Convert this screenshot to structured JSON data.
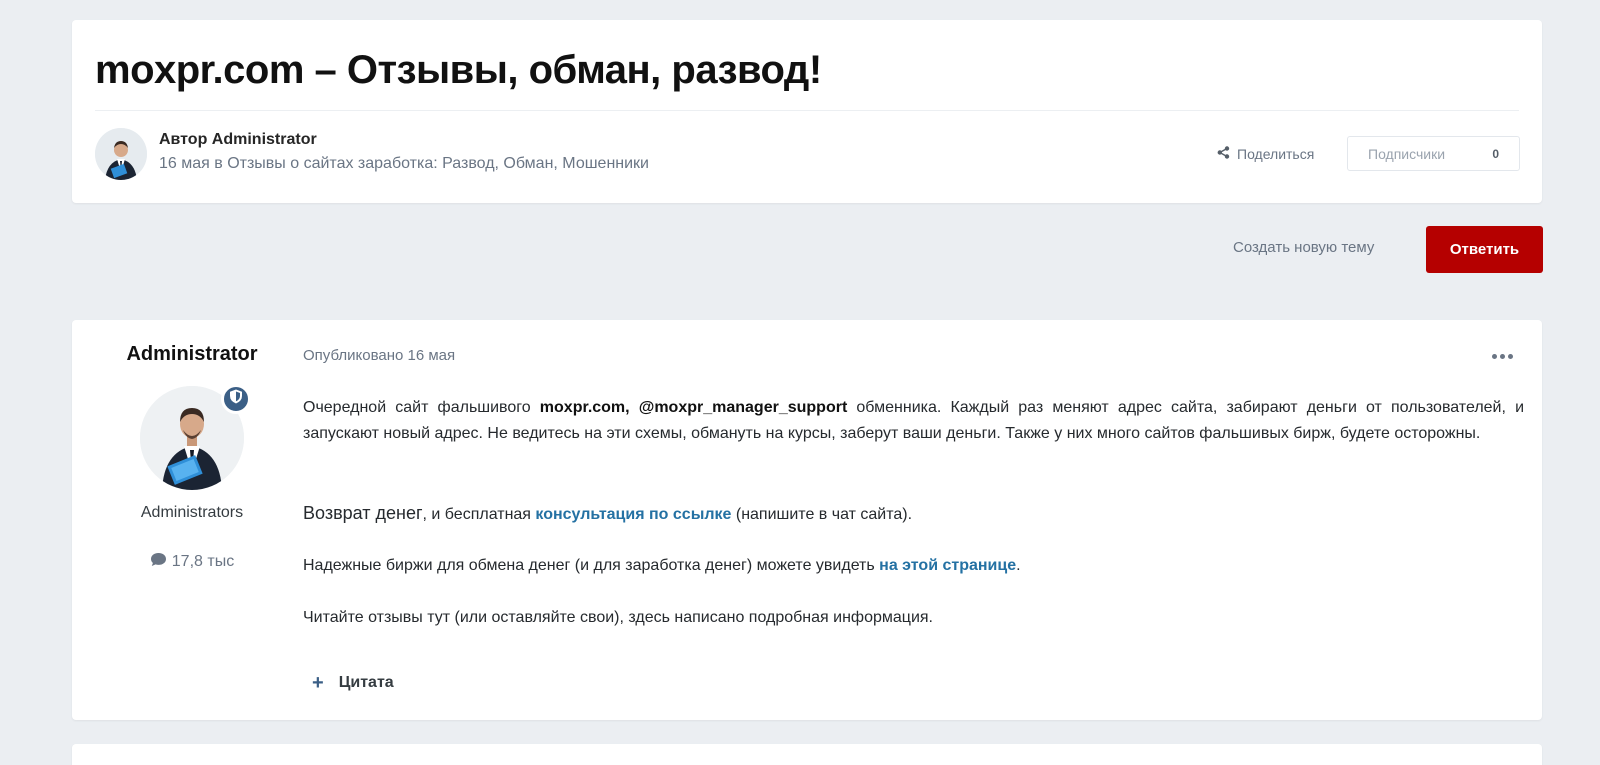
{
  "topic": {
    "title": "moxpr.com – Отзывы, обман, развод!",
    "author_line": "Автор Administrator",
    "meta_line": "16 мая в Отзывы о сайтах заработка: Развод, Обман, Мошенники",
    "share_label": "Поделиться",
    "followers_label": "Подписчики",
    "followers_count": "0"
  },
  "actions": {
    "new_topic_label": "Создать новую тему",
    "reply_label": "Ответить"
  },
  "post": {
    "author_name": "Administrator",
    "group": "Administrators",
    "post_count": "17,8 тыс",
    "posted": "Опубликовано 16 мая",
    "p1": {
      "t1": "Очередной сайт фальшивого ",
      "b1": "moxpr.com, @moxpr_manager_support",
      "t2": " обменника. Каждый раз меняют адрес сайта, забирают деньги от пользователей, и запускают новый адрес. Не ведитесь на эти схемы, обмануть на курсы, заберут ваши деньги. Также у них много сайтов фальшивых бирж, будете осторожны."
    },
    "p2": {
      "t1": "Возврат денег",
      "t2": ", и бесплатная ",
      "link": "консультация по ссылке",
      "t3": "  (напишите в чат сайта)."
    },
    "p3": {
      "t1": "Надежные биржи для обмена денег (и для заработка денег) можете увидеть ",
      "link": "на этой странице",
      "t2": "."
    },
    "p4": "Читайте отзывы тут (или оставляйте свои), здесь написано подробная информация.",
    "quote_label": "Цитата"
  },
  "colors": {
    "accent_red": "#b50000",
    "link_blue": "#2471a3",
    "badge_blue": "#3b5f86",
    "background": "#ebeef2"
  },
  "icons": [
    "share-icon",
    "comment-icon",
    "shield-icon",
    "more-options-icon",
    "plus-icon"
  ]
}
